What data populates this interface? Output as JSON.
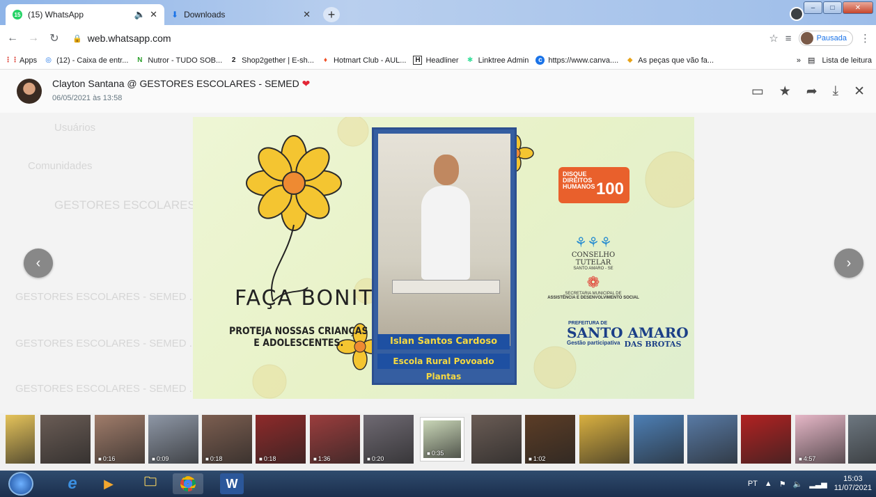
{
  "browser": {
    "tabs": [
      {
        "label": "(15) WhatsApp",
        "badge": "15"
      },
      {
        "label": "Downloads"
      }
    ],
    "url": "web.whatsapp.com",
    "profile_status": "Pausada",
    "bookmarks": [
      {
        "label": "Apps",
        "icon": "apps-grid-icon"
      },
      {
        "label": "(12) - Caixa de entr...",
        "icon": "inbox-icon"
      },
      {
        "label": "Nutror - TUDO SOB...",
        "icon": "nutror-icon"
      },
      {
        "label": "Shop2gether | E-sh...",
        "icon": "shop2gether-icon"
      },
      {
        "label": "Hotmart Club - AUL...",
        "icon": "hotmart-icon"
      },
      {
        "label": "Headliner",
        "icon": "headliner-icon"
      },
      {
        "label": "Linktree Admin",
        "icon": "linktree-icon"
      },
      {
        "label": "https://www.canva....",
        "icon": "canva-icon"
      },
      {
        "label": "As peças que vão fa...",
        "icon": "pieces-icon"
      }
    ],
    "reading_list": "Lista de leitura",
    "overflow": "»"
  },
  "media_viewer": {
    "sender": "Clayton Santana @ GESTORES ESCOLARES - SEMED",
    "date": "06/05/2021 às 13:58",
    "image": {
      "headline": "FAÇA BONITO",
      "subline_1": "PROTEJA NOSSAS CRIANÇAS",
      "subline_2": "E ADOLESCENTES.",
      "student_name": "Islan Santos Cardoso",
      "school": "Escola Rural Povoado Plantas",
      "disque_label": "DISQUE DIREITOS HUMANOS",
      "disque_number": "100",
      "conselho": "CONSELHO TUTELAR",
      "conselho_sub": "SANTO AMARO - SE",
      "secretaria": "SECRETARIA MUNICIPAL DE",
      "secretaria_2": "ASSISTÊNCIA E DESENVOLVIMENTO SOCIAL",
      "prefeitura": "PREFEITURA DE",
      "city": "SANTO AMARO",
      "gestao": "Gestão participativa",
      "das_brotas": "DAS BROTAS"
    },
    "thumbnails": [
      {
        "duration": "",
        "color": "#e5c35a"
      },
      {
        "duration": "",
        "color": "#6a5c55"
      },
      {
        "duration": "0:16",
        "color": "#a07c6a"
      },
      {
        "duration": "0:09",
        "color": "#8e97a6"
      },
      {
        "duration": "0:18",
        "color": "#7c5e50"
      },
      {
        "duration": "0:18",
        "color": "#8e2a2a"
      },
      {
        "duration": "1:36",
        "color": "#9b3d3d"
      },
      {
        "duration": "0:20",
        "color": "#6f6a73"
      },
      {
        "duration": "0:35",
        "color": "#c9d6b7"
      },
      {
        "duration": "",
        "color": "#6a5c55"
      },
      {
        "duration": "1:02",
        "color": "#5c3d26"
      },
      {
        "duration": "",
        "color": "#d9b040"
      },
      {
        "duration": "",
        "color": "#4d7fb5"
      },
      {
        "duration": "",
        "color": "#587aa5"
      },
      {
        "duration": "",
        "color": "#b22222"
      },
      {
        "duration": "4:57",
        "color": "#e6b7c7"
      },
      {
        "duration": "",
        "color": "#6d7780"
      }
    ]
  },
  "background_chats": [
    "Usuários",
    "Comunidades",
    "GESTORES ESCOLARES - ...",
    "GESTORES ESCOLARES - SEMED ...",
    "GESTORES ESCOLARES - SEMED ...",
    "GESTORES ESCOLARES - SEMED ..."
  ],
  "taskbar": {
    "language": "PT",
    "time": "15:03",
    "date": "11/07/2021"
  }
}
